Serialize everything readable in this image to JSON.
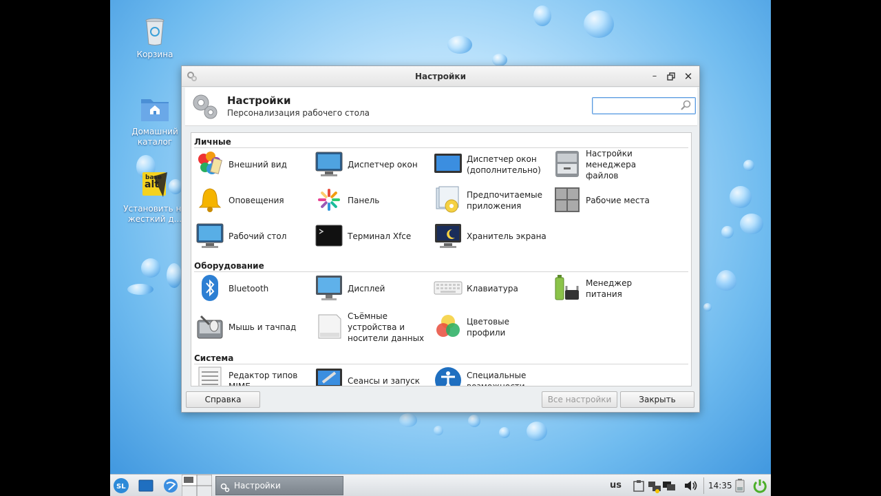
{
  "desktop": {
    "icons": [
      {
        "label": "Корзина"
      },
      {
        "label": "Домашний каталог"
      },
      {
        "label": "Установить на жесткий д..."
      }
    ],
    "install_badge": {
      "top": "base",
      "bottom": "alt"
    }
  },
  "window": {
    "title": "Настройки",
    "header_title": "Настройки",
    "header_subtitle": "Персонализация рабочего стола",
    "search_placeholder": "",
    "sections": [
      {
        "title": "Личные",
        "items": [
          {
            "label": "Внешний вид",
            "icon": "appearance-icon"
          },
          {
            "label": "Диспетчер окон",
            "icon": "window-manager-icon"
          },
          {
            "label": "Диспетчер окон (дополнительно)",
            "icon": "window-manager-tweaks-icon"
          },
          {
            "label": "Настройки менеджера файлов",
            "icon": "file-manager-icon"
          },
          {
            "label": "Оповещения",
            "icon": "bell-icon"
          },
          {
            "label": "Панель",
            "icon": "panel-icon"
          },
          {
            "label": "Предпочитаемые приложения",
            "icon": "preferred-apps-icon"
          },
          {
            "label": "Рабочие места",
            "icon": "workspaces-icon"
          },
          {
            "label": "Рабочий стол",
            "icon": "desktop-icon"
          },
          {
            "label": "Терминал Xfce",
            "icon": "terminal-icon"
          },
          {
            "label": "Хранитель экрана",
            "icon": "screensaver-icon"
          }
        ]
      },
      {
        "title": "Оборудование",
        "items": [
          {
            "label": "Bluetooth",
            "icon": "bluetooth-icon"
          },
          {
            "label": "Дисплей",
            "icon": "display-icon"
          },
          {
            "label": "Клавиатура",
            "icon": "keyboard-icon"
          },
          {
            "label": "Менеджер питания",
            "icon": "power-manager-icon"
          },
          {
            "label": "Мышь и тачпад",
            "icon": "mouse-icon"
          },
          {
            "label": "Съёмные устройства и носители данных",
            "icon": "removable-drive-icon"
          },
          {
            "label": "Цветовые профили",
            "icon": "color-profiles-icon"
          }
        ]
      },
      {
        "title": "Система",
        "items": [
          {
            "label": "Редактор типов MIME",
            "icon": "mime-editor-icon"
          },
          {
            "label": "Сеансы и запуск",
            "icon": "session-icon"
          },
          {
            "label": "Специальные возможности",
            "icon": "accessibility-icon"
          }
        ]
      }
    ],
    "buttons": {
      "help": "Справка",
      "all_settings": "Все настройки",
      "close": "Закрыть"
    }
  },
  "taskbar": {
    "task_label": "Настройки",
    "keyboard_layout": "us",
    "clock": "14:35"
  },
  "colors": {
    "accent": "#3d8ee0",
    "taskbar_active": "#8a9199"
  }
}
